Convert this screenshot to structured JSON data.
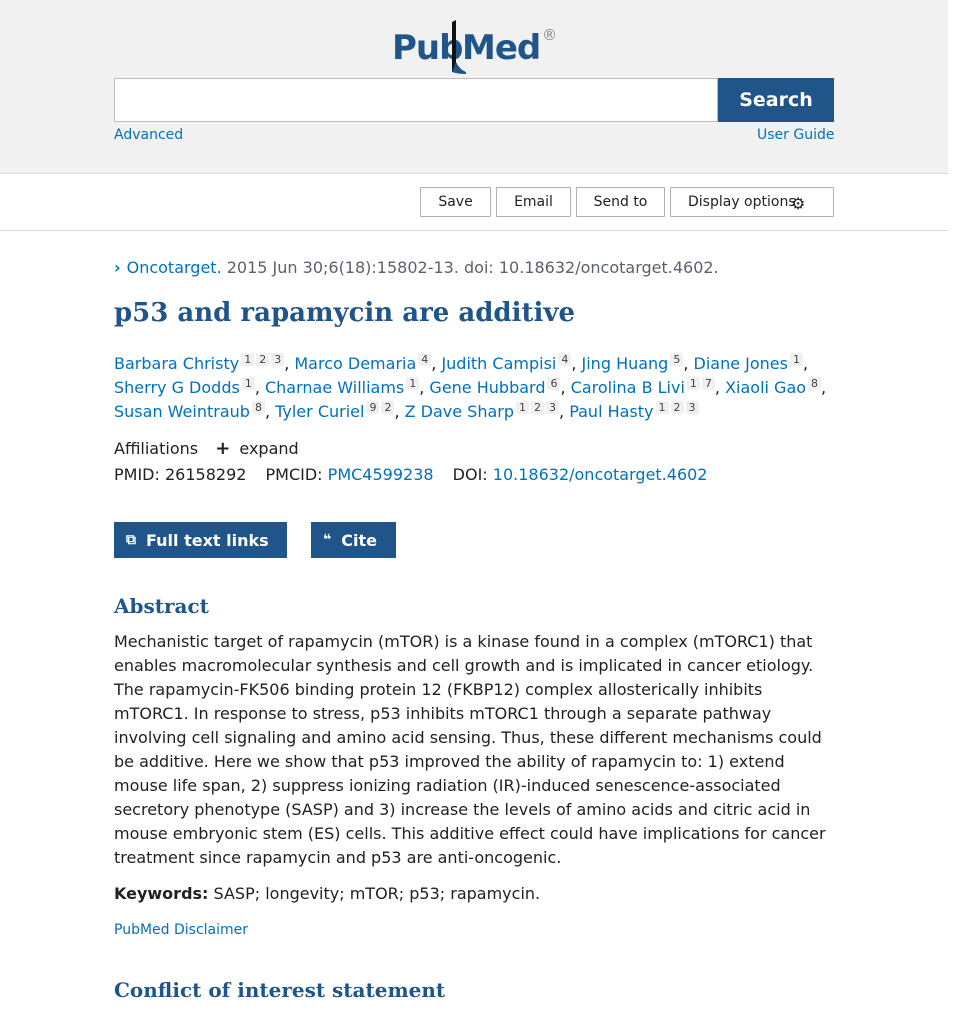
{
  "logo": {
    "part1": "Pub",
    "part2": "Med",
    "reg": "®"
  },
  "search": {
    "value": "",
    "placeholder": "",
    "button": "Search"
  },
  "links": {
    "advanced": "Advanced",
    "user_guide": "User Guide"
  },
  "toolbar": {
    "save": "Save",
    "email": "Email",
    "send_to": "Send to",
    "display_options": "Display options"
  },
  "citation": {
    "journal": "Oncotarget.",
    "details": " 2015 Jun 30;6(18):15802-13. doi: 10.18632/oncotarget.4602."
  },
  "article": {
    "title": "p53 and rapamycin are additive",
    "authors": [
      {
        "name": "Barbara Christy",
        "affs": [
          "1",
          "2",
          "3"
        ]
      },
      {
        "name": "Marco Demaria",
        "affs": [
          "4"
        ]
      },
      {
        "name": "Judith Campisi",
        "affs": [
          "4"
        ]
      },
      {
        "name": "Jing Huang",
        "affs": [
          "5"
        ]
      },
      {
        "name": "Diane Jones",
        "affs": [
          "1"
        ]
      },
      {
        "name": "Sherry G Dodds",
        "affs": [
          "1"
        ]
      },
      {
        "name": "Charnae Williams",
        "affs": [
          "1"
        ]
      },
      {
        "name": "Gene Hubbard",
        "affs": [
          "6"
        ]
      },
      {
        "name": "Carolina B Livi",
        "affs": [
          "1",
          "7"
        ]
      },
      {
        "name": "Xiaoli Gao",
        "affs": [
          "8"
        ]
      },
      {
        "name": "Susan Weintraub",
        "affs": [
          "8"
        ]
      },
      {
        "name": "Tyler Curiel",
        "affs": [
          "9",
          "2"
        ]
      },
      {
        "name": "Z Dave Sharp",
        "affs": [
          "1",
          "2",
          "3"
        ]
      },
      {
        "name": "Paul Hasty",
        "affs": [
          "1",
          "2",
          "3"
        ]
      }
    ],
    "affiliations_label": "Affiliations",
    "expand_label": "expand",
    "pmid_label": "PMID:",
    "pmid": "26158292",
    "pmcid_label": "PMCID:",
    "pmcid": "PMC4599238",
    "doi_label": "DOI:",
    "doi": "10.18632/oncotarget.4602"
  },
  "actions": {
    "full_text": "Full text links",
    "cite": "Cite"
  },
  "abstract": {
    "heading": "Abstract",
    "text": "Mechanistic target of rapamycin (mTOR) is a kinase found in a complex (mTORC1) that enables macromolecular synthesis and cell growth and is implicated in cancer etiology. The rapamycin-FK506 binding protein 12 (FKBP12) complex allosterically inhibits mTORC1. In response to stress, p53 inhibits mTORC1 through a separate pathway involving cell signaling and amino acid sensing. Thus, these different mechanisms could be additive. Here we show that p53 improved the ability of rapamycin to: 1) extend mouse life span, 2) suppress ionizing radiation (IR)-induced senescence-associated secretory phenotype (SASP) and 3) increase the levels of amino acids and citric acid in mouse embryonic stem (ES) cells. This additive effect could have implications for cancer treatment since rapamycin and p53 are anti-oncogenic.",
    "keywords_label": "Keywords:",
    "keywords": " SASP; longevity; mTOR; p53; rapamycin.",
    "disclaimer": "PubMed Disclaimer"
  },
  "coi": {
    "heading": "Conflict of interest statement"
  }
}
